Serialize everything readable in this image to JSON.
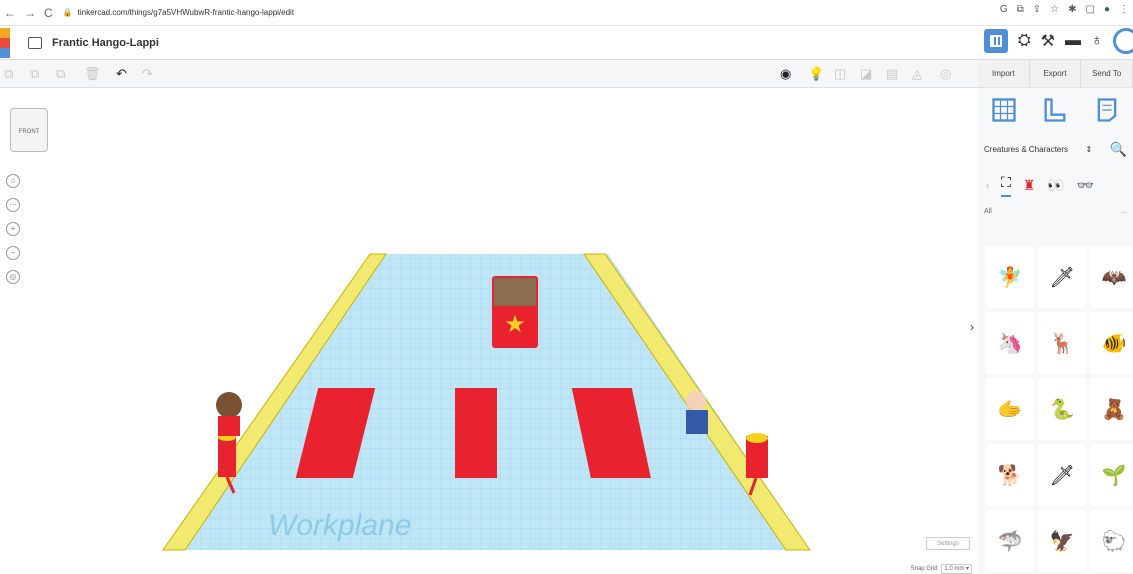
{
  "browser": {
    "url": "tinkercad.com/things/g7a5VHWubwR-frantic-hango-lappi/edit",
    "nav": [
      "←",
      "→",
      "C"
    ],
    "icons": [
      "G",
      "⧉",
      "⇪",
      "☆",
      "✱",
      "▢",
      "●",
      "⋮"
    ]
  },
  "app": {
    "title": "Frantic Hango-Lappi",
    "logo_colors": [
      "#f5a623",
      "#e74c3c",
      "#4f8fd8"
    ]
  },
  "toolbar": {
    "copy": "⧉",
    "paste": "⧉",
    "duplicate": "⧉",
    "delete": "🗑",
    "undo": "↶",
    "redo": "↷",
    "right_tools": [
      "◉",
      "💡",
      "◫",
      "◪",
      "▤",
      "◬",
      "◎"
    ]
  },
  "panel": {
    "import": "Import",
    "export": "Export",
    "send_to": "Send To",
    "category": "Creatures & Characters",
    "all_label": "All",
    "more": "...",
    "shape_icons": [
      "🧚",
      "🗡",
      "🦇",
      "🦄",
      "🦌",
      "🐠",
      "🫱",
      "🐍",
      "🧸",
      "🐕",
      "🗡",
      "🌱",
      "🦈",
      "🦅",
      "🐑"
    ]
  },
  "viewport": {
    "view_label": "FRONT",
    "workplane_label": "Workplane",
    "settings": "Settings",
    "snap_grid_label": "Snap Grid",
    "snap_grid_value": "1.0 mm ▾"
  },
  "colors": {
    "accent": "#4f8fd8",
    "grid": "#a8d9f0",
    "lane": "#f5e96a",
    "red": "#e8232f"
  }
}
